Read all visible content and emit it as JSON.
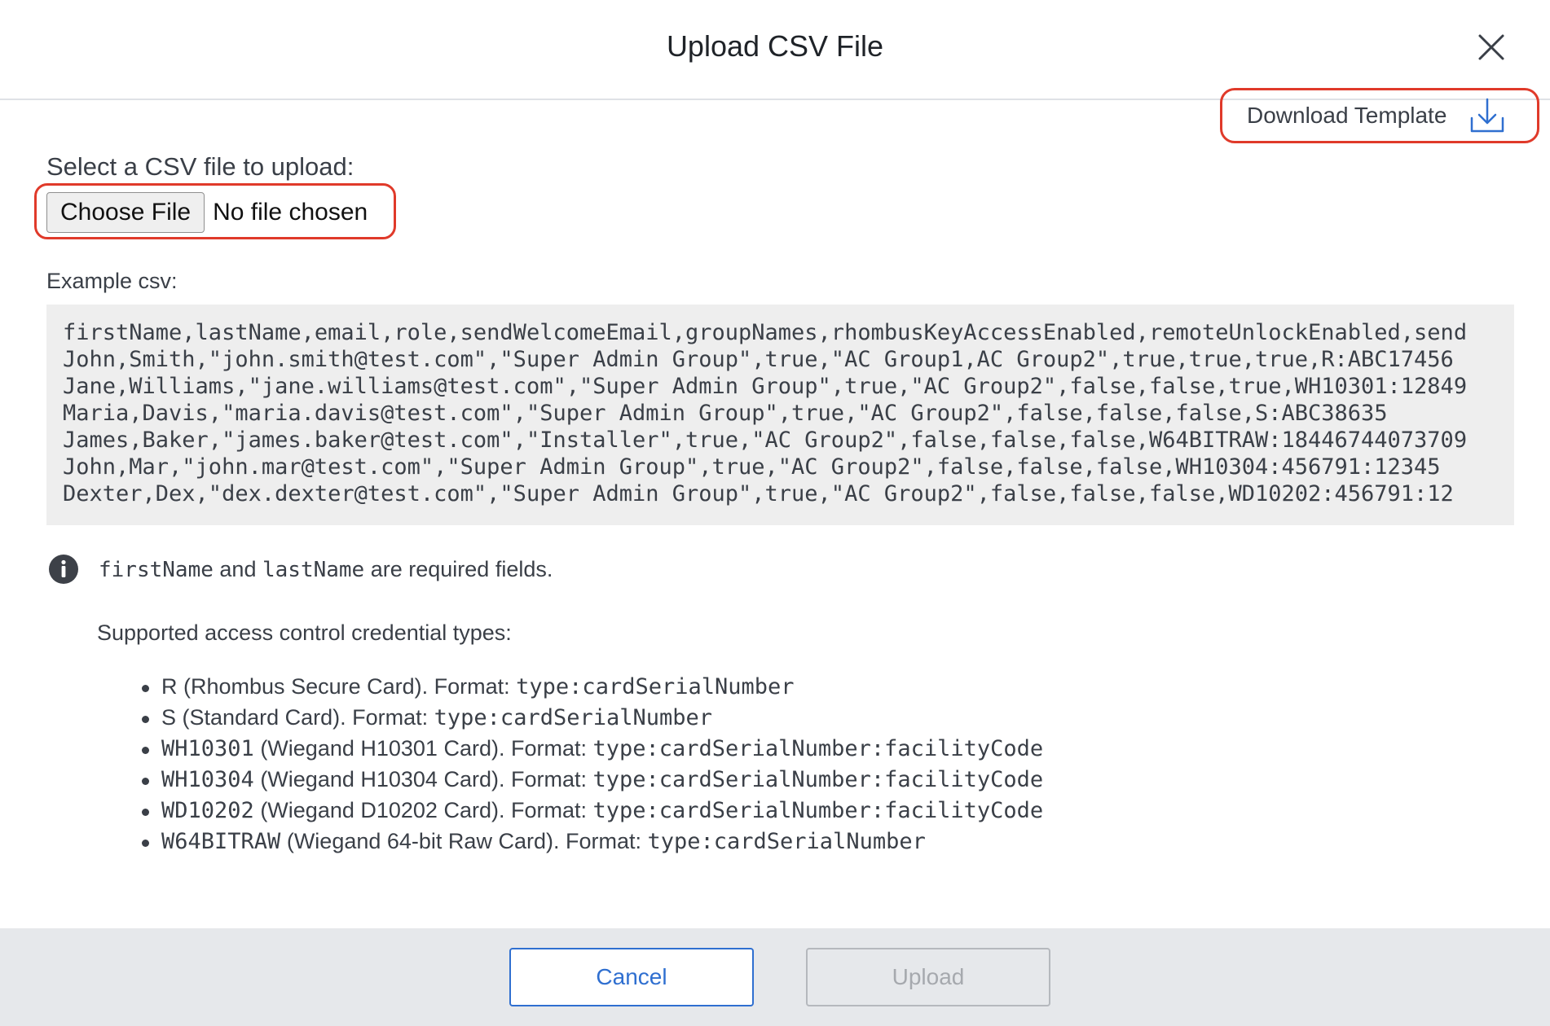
{
  "dialog": {
    "title": "Upload CSV File",
    "close_icon": "close-icon"
  },
  "download_template": {
    "label": "Download Template",
    "icon": "download-icon",
    "accent": "#2f6fd0"
  },
  "file_upload": {
    "label": "Select a CSV file to upload:",
    "button_label": "Choose File",
    "status": "No file chosen"
  },
  "example": {
    "label": "Example csv:",
    "lines": [
      "firstName,lastName,email,role,sendWelcomeEmail,groupNames,rhombusKeyAccessEnabled,remoteUnlockEnabled,send",
      "John,Smith,\"john.smith@test.com\",\"Super Admin Group\",true,\"AC Group1,AC Group2\",true,true,true,R:ABC17456",
      "Jane,Williams,\"jane.williams@test.com\",\"Super Admin Group\",true,\"AC Group2\",false,false,true,WH10301:12849",
      "Maria,Davis,\"maria.davis@test.com\",\"Super Admin Group\",true,\"AC Group2\",false,false,false,S:ABC38635",
      "James,Baker,\"james.baker@test.com\",\"Installer\",true,\"AC Group2\",false,false,false,W64BITRAW:18446744073709",
      "John,Mar,\"john.mar@test.com\",\"Super Admin Group\",true,\"AC Group2\",false,false,false,WH10304:456791:12345",
      "Dexter,Dex,\"dex.dexter@test.com\",\"Super Admin Group\",true,\"AC Group2\",false,false,false,WD10202:456791:12"
    ]
  },
  "info": {
    "icon": "info-icon",
    "field1": "firstName",
    "and": "and",
    "field2": "lastName",
    "suffix": "are required fields."
  },
  "credentials": {
    "heading": "Supported access control credential types:",
    "items": [
      {
        "code": "R",
        "desc": "(Rhombus Secure Card). Format:",
        "format": "type:cardSerialNumber",
        "code_mono": false
      },
      {
        "code": "S",
        "desc": "(Standard Card). Format:",
        "format": "type:cardSerialNumber",
        "code_mono": false
      },
      {
        "code": "WH10301",
        "desc": "(Wiegand H10301 Card). Format:",
        "format": "type:cardSerialNumber:facilityCode",
        "code_mono": true
      },
      {
        "code": "WH10304",
        "desc": "(Wiegand H10304 Card). Format:",
        "format": "type:cardSerialNumber:facilityCode",
        "code_mono": true
      },
      {
        "code": "WD10202",
        "desc": "(Wiegand D10202 Card). Format:",
        "format": "type:cardSerialNumber:facilityCode",
        "code_mono": true
      },
      {
        "code": "W64BITRAW",
        "desc": "(Wiegand 64-bit Raw Card). Format:",
        "format": "type:cardSerialNumber",
        "code_mono": true
      }
    ]
  },
  "footer": {
    "cancel_label": "Cancel",
    "upload_label": "Upload",
    "upload_disabled": true
  }
}
